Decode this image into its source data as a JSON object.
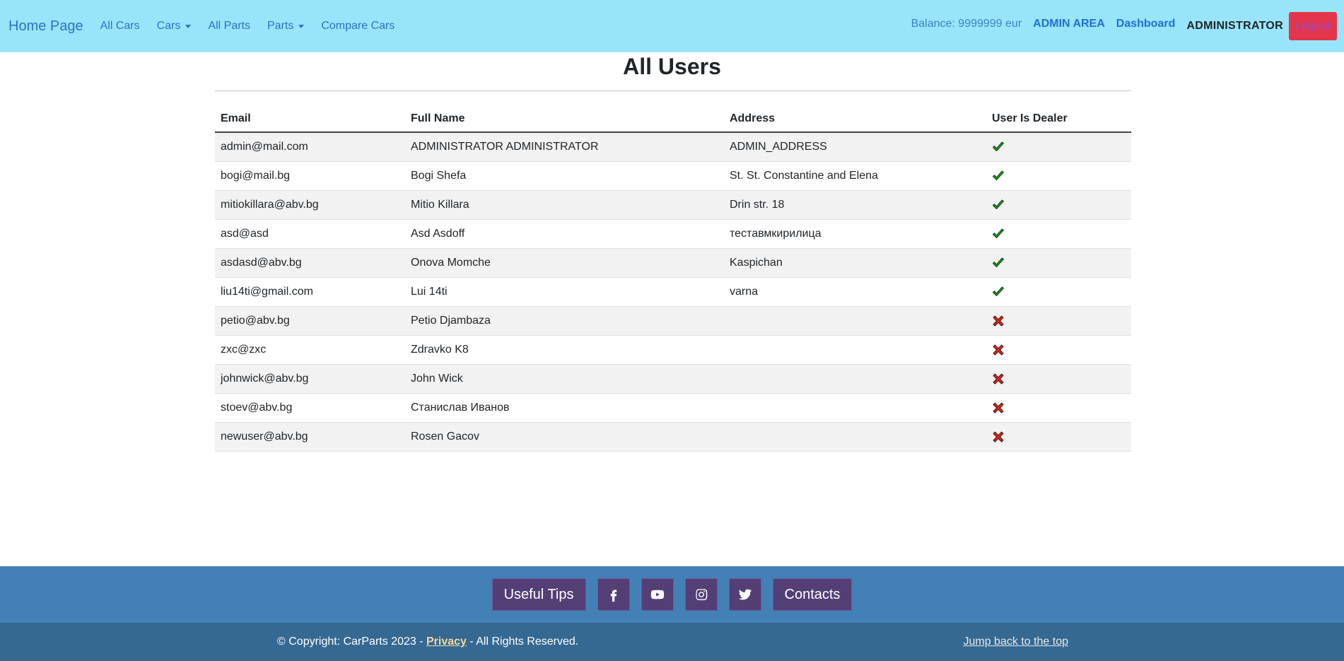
{
  "navbar": {
    "brand": "Home Page",
    "links": [
      {
        "label": "All Cars",
        "dropdown": false
      },
      {
        "label": "Cars",
        "dropdown": true
      },
      {
        "label": "All Parts",
        "dropdown": false
      },
      {
        "label": "Parts",
        "dropdown": true
      },
      {
        "label": "Compare Cars",
        "dropdown": false
      }
    ],
    "balance": "Balance: 9999999 eur",
    "admin_area": "ADMIN AREA",
    "dashboard": "Dashboard",
    "username": "ADMINISTRATOR",
    "logout": "Logout"
  },
  "page": {
    "title": "All Users"
  },
  "table": {
    "headers": [
      "Email",
      "Full Name",
      "Address",
      "User Is Dealer"
    ],
    "rows": [
      {
        "email": "admin@mail.com",
        "full_name": "ADMINISTRATOR ADMINISTRATOR",
        "address": "ADMIN_ADDRESS",
        "is_dealer": true
      },
      {
        "email": "bogi@mail.bg",
        "full_name": "Bogi Shefa",
        "address": "St. St. Constantine and Elena",
        "is_dealer": true
      },
      {
        "email": "mitiokillara@abv.bg",
        "full_name": "Mitio Killara",
        "address": "Drin str. 18",
        "is_dealer": true
      },
      {
        "email": "asd@asd",
        "full_name": "Asd Asdoff",
        "address": "теставмкирилица",
        "is_dealer": true
      },
      {
        "email": "asdasd@abv.bg",
        "full_name": "Onova Momche",
        "address": "Kaspichan",
        "is_dealer": true
      },
      {
        "email": "liu14ti@gmail.com",
        "full_name": "Lui 14ti",
        "address": "varna",
        "is_dealer": true
      },
      {
        "email": "petio@abv.bg",
        "full_name": "Petio Djambaza",
        "address": "",
        "is_dealer": false
      },
      {
        "email": "zxc@zxc",
        "full_name": "Zdravko K8",
        "address": "",
        "is_dealer": false
      },
      {
        "email": "johnwick@abv.bg",
        "full_name": "John Wick",
        "address": "",
        "is_dealer": false
      },
      {
        "email": "stoev@abv.bg",
        "full_name": "Станислав Иванов",
        "address": "",
        "is_dealer": false
      },
      {
        "email": "newuser@abv.bg",
        "full_name": "Rosen Gacov",
        "address": "",
        "is_dealer": false
      }
    ]
  },
  "footer": {
    "useful_tips": "Useful Tips",
    "social_icons": [
      "facebook-icon",
      "youtube-icon",
      "instagram-icon",
      "twitter-icon"
    ],
    "contacts": "Contacts",
    "copyright_prefix": "© Copyright: CarParts 2023 - ",
    "privacy": "Privacy",
    "copyright_suffix": " - All Rights Reserved.",
    "jump_top": "Jump back to the top"
  },
  "colors": {
    "navbar_bg": "#98e5fb",
    "link": "#2a72c9",
    "logout_bg": "#e3364b",
    "footer_top_bg": "#4380b5",
    "footer_bottom_bg": "#356992",
    "footer_button_bg": "#533f75",
    "check_green": "#22a122",
    "cross_red": "#d62b1f"
  }
}
